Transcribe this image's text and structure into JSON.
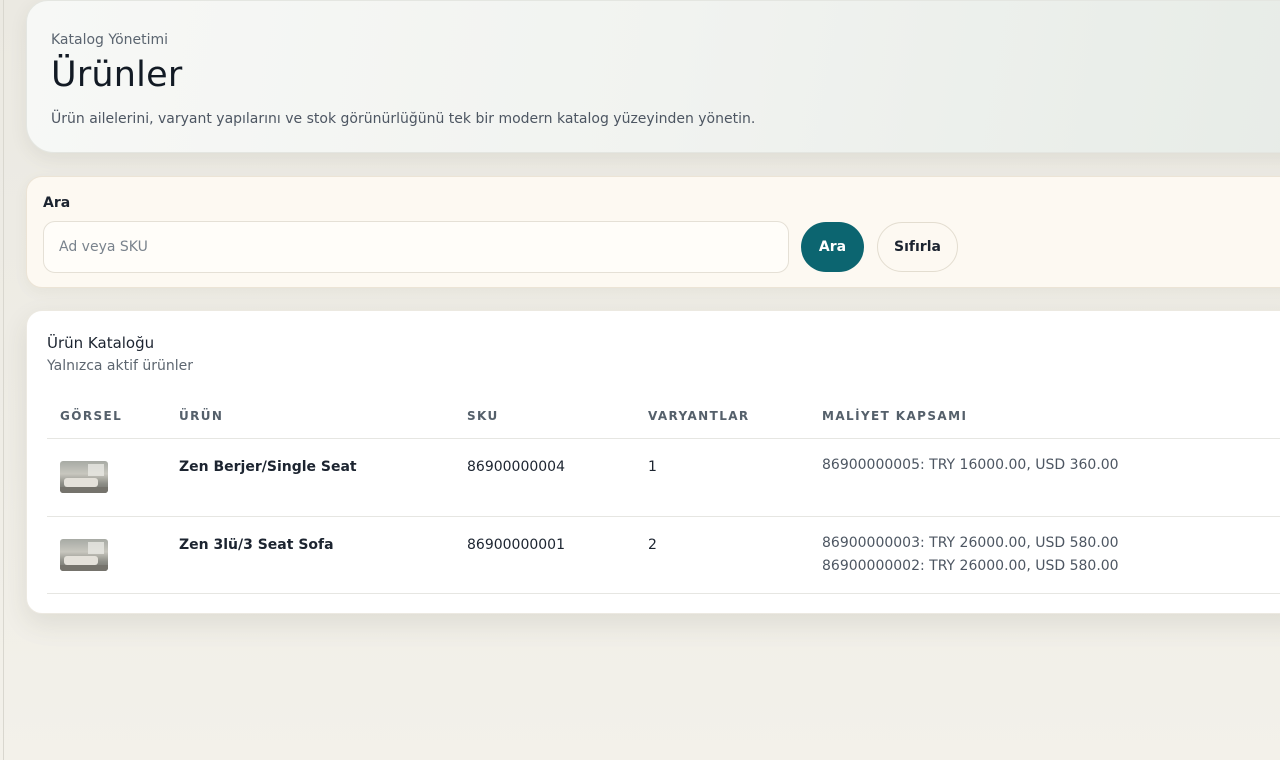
{
  "hero": {
    "eyebrow": "Katalog Yönetimi",
    "title": "Ürünler",
    "description": "Ürün ailelerini, varyant yapılarını ve stok görünürlüğünü tek bir modern katalog yüzeyinden yönetin."
  },
  "search": {
    "label": "Ara",
    "placeholder": "Ad veya SKU",
    "value": "",
    "search_button": "Ara",
    "reset_button": "Sıfırla"
  },
  "catalog": {
    "title": "Ürün Kataloğu",
    "subtitle": "Yalnızca aktif ürünler",
    "columns": [
      "GÖRSEL",
      "ÜRÜN",
      "SKU",
      "VARYANTLAR",
      "MALİYET KAPSAMI"
    ],
    "rows": [
      {
        "image": "sofa-thumbnail",
        "name": "Zen Berjer/Single Seat",
        "sku": "86900000004",
        "variants": "1",
        "costs": [
          "86900000005: TRY 16000.00, USD 360.00"
        ]
      },
      {
        "image": "sofa-thumbnail",
        "name": "Zen 3lü/3 Seat Sofa",
        "sku": "86900000001",
        "variants": "2",
        "costs": [
          "86900000003: TRY 26000.00, USD 580.00",
          "86900000002: TRY 26000.00, USD 580.00"
        ]
      }
    ]
  },
  "colors": {
    "accent": "#0c6570",
    "search_bg": "#fdf9f2",
    "text": "#1c2430"
  }
}
